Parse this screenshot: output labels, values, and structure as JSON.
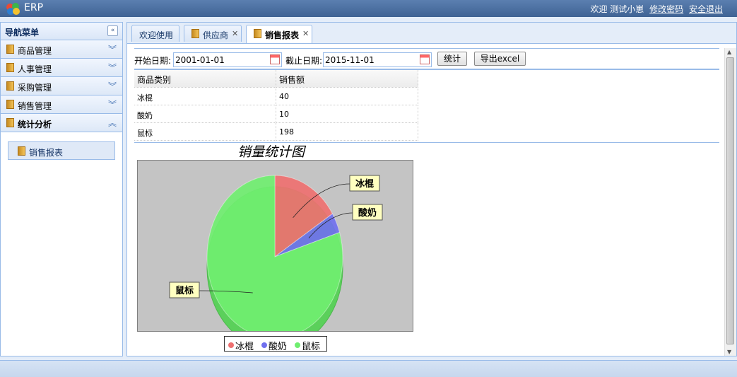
{
  "app": {
    "title": "ERP"
  },
  "header": {
    "welcome": "欢迎 测试小崽",
    "change_password": "修改密码",
    "logout": "安全退出"
  },
  "sidebar": {
    "title": "导航菜单",
    "items": [
      {
        "label": "商品管理",
        "icon": "folder-icon",
        "expanded": false
      },
      {
        "label": "人事管理",
        "icon": "folder-icon",
        "expanded": false
      },
      {
        "label": "采购管理",
        "icon": "folder-icon",
        "expanded": false
      },
      {
        "label": "销售管理",
        "icon": "folder-icon",
        "expanded": false
      },
      {
        "label": "统计分析",
        "icon": "folder-icon",
        "expanded": true
      }
    ],
    "sub_items": [
      {
        "label": "销售报表",
        "icon": "folder-icon"
      }
    ]
  },
  "tabs": [
    {
      "label": "欢迎使用",
      "closable": false,
      "active": false
    },
    {
      "label": "供应商",
      "closable": true,
      "active": false
    },
    {
      "label": "销售报表",
      "closable": true,
      "active": true
    }
  ],
  "filter": {
    "start_label": "开始日期:",
    "start_value": "2001-01-01",
    "end_label": "截止日期:",
    "end_value": "2015-11-01",
    "stat_button": "统计",
    "export_button": "导出excel"
  },
  "table": {
    "columns": [
      "商品类别",
      "销售额"
    ],
    "rows": [
      [
        "冰棍",
        "40"
      ],
      [
        "酸奶",
        "10"
      ],
      [
        "鼠标",
        "198"
      ]
    ]
  },
  "colors": {
    "冰棍": "#ee7070",
    "酸奶": "#7070ee",
    "鼠标": "#70ee70"
  },
  "chart_data": {
    "type": "pie",
    "title": "销量统计图",
    "categories": [
      "冰棍",
      "酸奶",
      "鼠标"
    ],
    "values": [
      40,
      10,
      198
    ],
    "legend": "bottom"
  }
}
